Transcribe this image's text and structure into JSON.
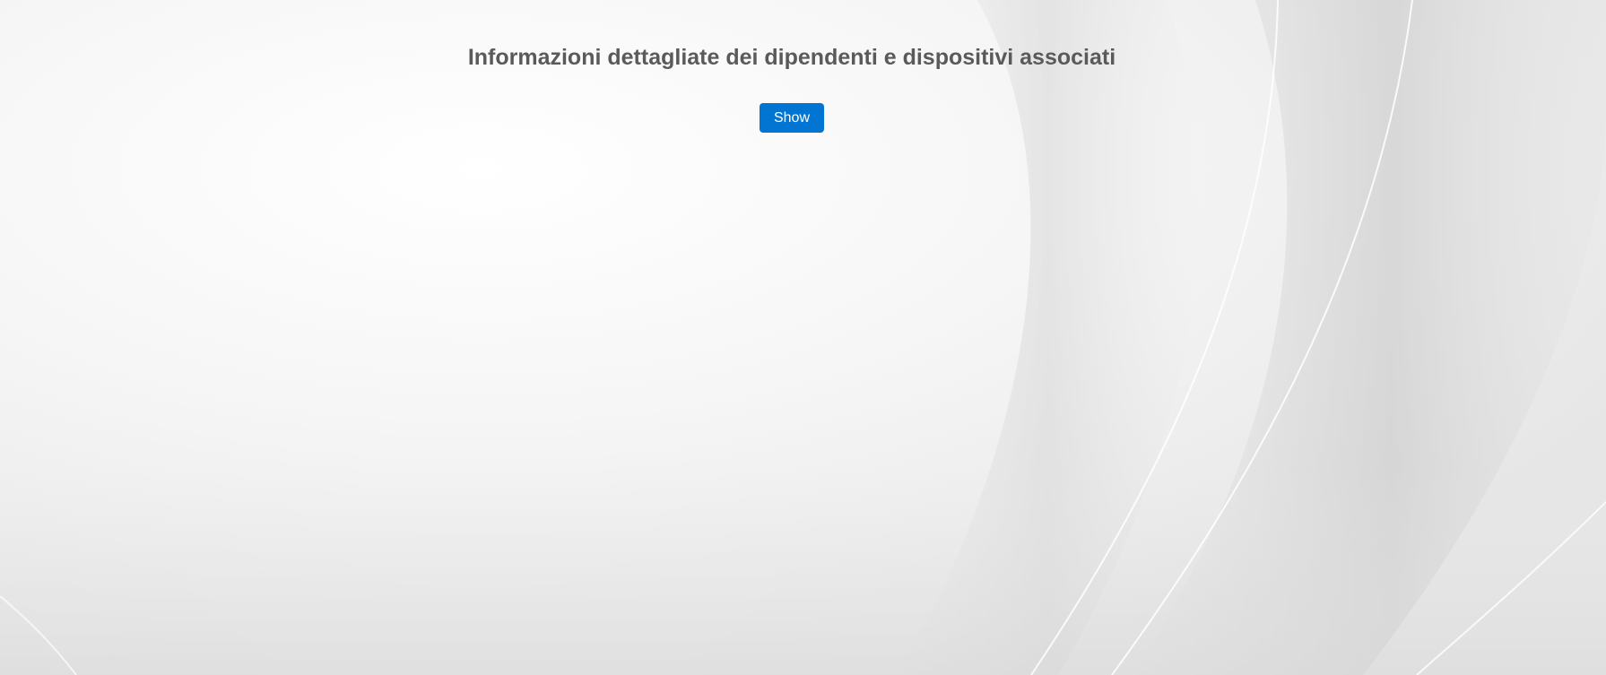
{
  "page": {
    "title": "Informazioni dettagliate dei dipendenti e dispositivi associati",
    "show_label": "Show"
  },
  "colors": {
    "title_text": "#5a5a5a",
    "button_bg": "#0274d1",
    "button_text": "#ffffff",
    "background": "#f3f3f3"
  }
}
